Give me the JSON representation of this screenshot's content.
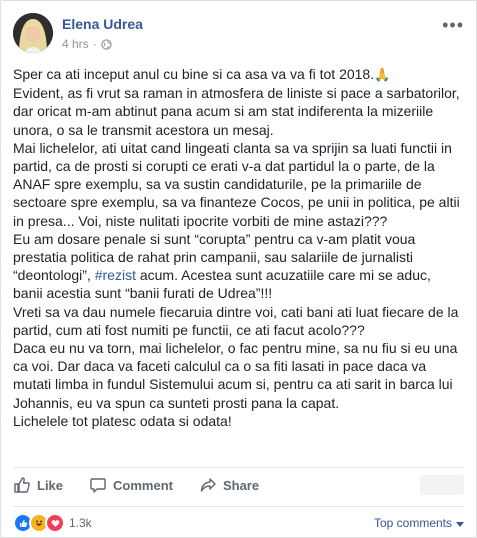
{
  "post": {
    "author": "Elena Udrea",
    "time": "4 hrs",
    "privacy_icon": "globe-icon",
    "more_label": "•••",
    "lines": [
      "Sper ca ati inceput anul cu bine si ca asa va va fi tot 2018.",
      "Evident, as fi vrut sa raman in atmosfera de liniste si pace a sarbatorilor, dar oricat m-am abtinut pana acum si am stat indiferenta la mizeriile unora, o sa le transmit acestora un mesaj.",
      "Mai lichelelor, ati uitat cand lingeati clanta sa va sprijin sa luati functii in partid, ca de prosti si corupti ce erati v-a dat partidul la o parte, de la ANAF spre exemplu, sa va sustin candidaturile, pe la primariile de sectoare spre exemplu, sa va finanteze Cocos, pe unii in politica, pe altii in presa... Voi, niste nulitati ipocrite vorbiti de mine astazi???",
      "Eu am dosare penale si sunt “corupta” pentru ca v-am platit voua prestatia politica de rahat prin campanii, sau salariile de jurnalisti “deontologi”,",
      "#rezist",
      " acum. Acestea sunt acuzatiile care mi se aduc, banii acestia sunt “banii furati de Udrea”!!!",
      "Vreti sa va dau numele fiecaruia dintre voi, cati bani ati luat fiecare de la partid, cum ati fost numiti pe functii, ce ati facut acolo???",
      "Daca eu nu va torn, mai lichelelor, o fac pentru mine, sa nu fiu si eu una ca voi. Dar daca va faceti calculul ca o sa fiti lasati in pace daca va mutati limba in fundul Sistemului acum si, pentru ca ati sarit in barca lui Johannis, eu va spun ca sunteti prosti pana la capat.",
      "Lichelele tot platesc odata si odata!"
    ],
    "emoji": "🙏"
  },
  "actions": {
    "like_label": "Like",
    "comment_label": "Comment",
    "share_label": "Share"
  },
  "footer": {
    "reaction_count": "1.3k",
    "top_comments_label": "Top comments"
  },
  "colors": {
    "link": "#365899",
    "text": "#1d2129",
    "muted": "#606770",
    "like_blue": "#1877f2",
    "haha_yellow": "#f7b125",
    "love_red": "#f33e58"
  }
}
